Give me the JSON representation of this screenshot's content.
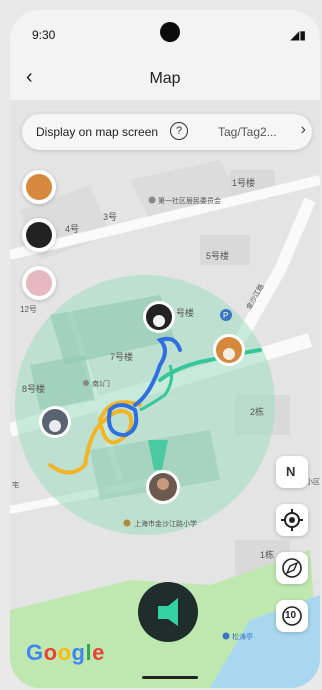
{
  "status": {
    "time": "9:30"
  },
  "header": {
    "title": "Map",
    "back_icon": "‹"
  },
  "display_bar": {
    "label": "Display on map screen",
    "help": "?",
    "value": "Tag/Tag2...",
    "chevron": "›"
  },
  "map_labels": {
    "l1": "1号楼",
    "l2": "第一社区居民委员会",
    "l3": "3号",
    "l4": "4号",
    "l5": "5号楼",
    "l6": "12号",
    "l7": "号楼",
    "l8": "7号楼",
    "l9": "南1门",
    "l10": "8号楼",
    "l11": "2栋",
    "l12": "上海市金沙江路小学",
    "l13": "1栋",
    "l14": "松涛亭",
    "l15": "小区",
    "l16": "宅",
    "l17": "金沙江路",
    "l18": "P"
  },
  "controls": {
    "compass": "N",
    "route_label": "10"
  },
  "logo": {
    "g1": "G",
    "o1": "o",
    "o2": "o",
    "g2": "g",
    "l": "l",
    "e": "e"
  },
  "colors": {
    "accent": "#2ec4a0",
    "dark": "#1f2d2d",
    "track_blue": "#2f6fe0",
    "track_yellow": "#f0b528",
    "track_green": "#35c79a"
  }
}
